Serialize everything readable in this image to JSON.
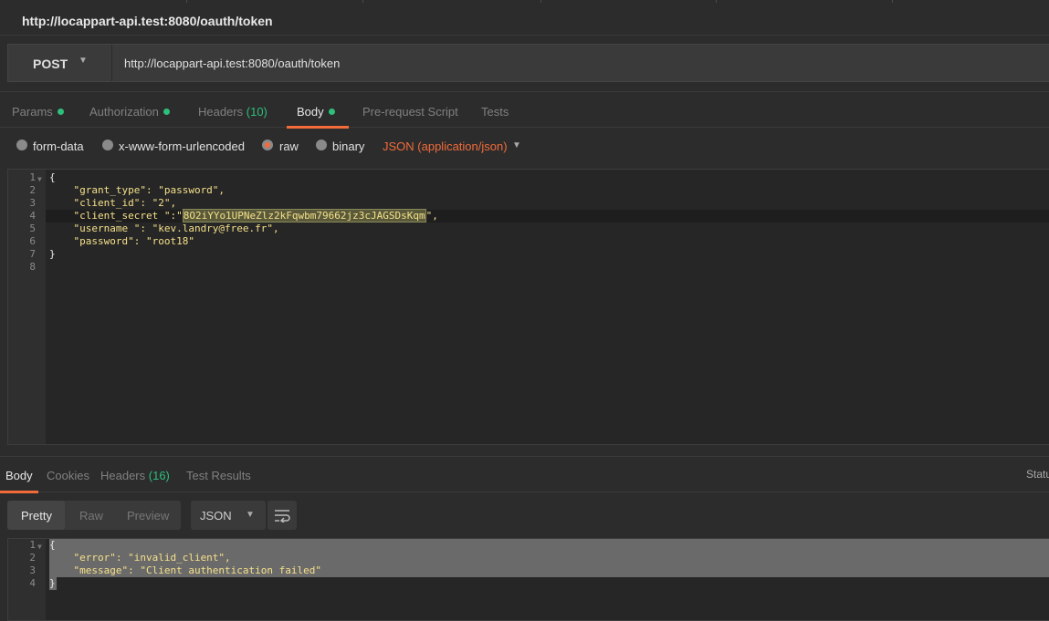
{
  "window": {
    "title": "http://locappart-api.test:8080/oauth/token"
  },
  "request": {
    "method": "POST",
    "url": "http://locappart-api.test:8080/oauth/token"
  },
  "request_tabs": [
    {
      "label": "Params",
      "dot": true
    },
    {
      "label": "Authorization",
      "dot": true
    },
    {
      "label": "Headers",
      "count": "(10)"
    },
    {
      "label": "Body",
      "dot": true,
      "active": true
    },
    {
      "label": "Pre-request Script"
    },
    {
      "label": "Tests"
    }
  ],
  "body_modes": {
    "form_data": "form-data",
    "urlencoded": "x-www-form-urlencoded",
    "raw": "raw",
    "binary": "binary",
    "selected": "raw",
    "content_type": "JSON (application/json)"
  },
  "request_body": {
    "line_numbers": [
      "1",
      "2",
      "3",
      "4",
      "5",
      "6",
      "7",
      "8"
    ],
    "lines": [
      "{",
      "    \"grant_type\": \"password\",",
      "    \"client_id\": \"2\",",
      "    \"client_secret \":\"",
      "    \"username \": \"kev.landry@free.fr\",",
      "    \"password\": \"root18\"",
      "}",
      ""
    ],
    "selected_text": "8O2iYYo1UPNeZlz2kFqwbm79662jz3cJAGSDsKqm",
    "line4_tail": "\","
  },
  "response_tabs": [
    {
      "label": "Body",
      "active": true
    },
    {
      "label": "Cookies"
    },
    {
      "label": "Headers",
      "count": "(16)"
    },
    {
      "label": "Test Results"
    }
  ],
  "status_label": "Statu",
  "response_toolbar": {
    "pretty": "Pretty",
    "raw": "Raw",
    "preview": "Preview",
    "format": "JSON"
  },
  "response_body": {
    "line_numbers": [
      "1",
      "2",
      "3",
      "4"
    ],
    "lines": [
      "{",
      "    \"error\": \"invalid_client\",",
      "    \"message\": \"Client authentication failed\"",
      "}"
    ]
  },
  "colors": {
    "accent": "#f26b3a",
    "dot": "#2ebf7b",
    "json_string": "#f5e08a"
  }
}
